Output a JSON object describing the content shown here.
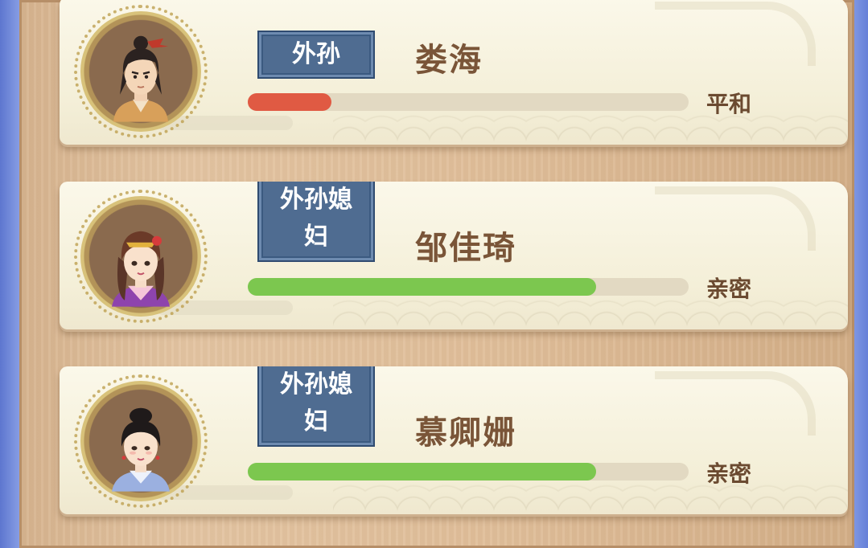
{
  "colors": {
    "bar_red": "#e05a43",
    "bar_green": "#7cc74f",
    "badge_blue": "#4f6c91",
    "name_brown": "#7a5538"
  },
  "relatives": [
    {
      "relation": "外孙",
      "name": "娄海",
      "affinity_fraction": 0.19,
      "bar_color": "#e05a43",
      "status": "平和",
      "avatar": "young-man-avatar"
    },
    {
      "relation": "外孙媳妇",
      "name": "邹佳琦",
      "affinity_fraction": 0.79,
      "bar_color": "#7cc74f",
      "status": "亲密",
      "avatar": "young-woman-avatar"
    },
    {
      "relation": "外孙媳妇",
      "name": "慕卿姗",
      "affinity_fraction": 0.79,
      "bar_color": "#7cc74f",
      "status": "亲密",
      "avatar": "woman-avatar"
    }
  ]
}
